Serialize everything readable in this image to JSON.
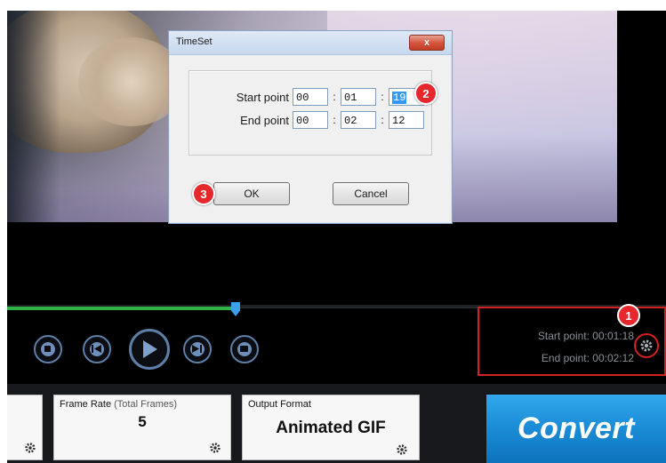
{
  "dialog": {
    "title": "TimeSet",
    "close_label": "x",
    "start_label": "Start point",
    "end_label": "End point",
    "start": {
      "h": "00",
      "m": "01",
      "s": "19"
    },
    "end": {
      "h": "00",
      "m": "02",
      "s": "12"
    },
    "ok_label": "OK",
    "cancel_label": "Cancel"
  },
  "badges": {
    "one": "1",
    "two": "2",
    "three": "3"
  },
  "info": {
    "start_text": "Start point: 00:01:18",
    "end_text": "End point: 00:02:12"
  },
  "timeline": {
    "progress_fraction": 0.35
  },
  "panels": {
    "frame_rate": {
      "title": "Frame Rate",
      "title_sub": "(Total Frames)",
      "value": "5"
    },
    "output_format": {
      "title": "Output Format",
      "value": "Animated GIF"
    }
  },
  "convert_label": "Convert",
  "colors": {
    "accent_blue": "#1a8bd6",
    "highlight_red": "#d42020",
    "progress_green": "#2fb346"
  }
}
